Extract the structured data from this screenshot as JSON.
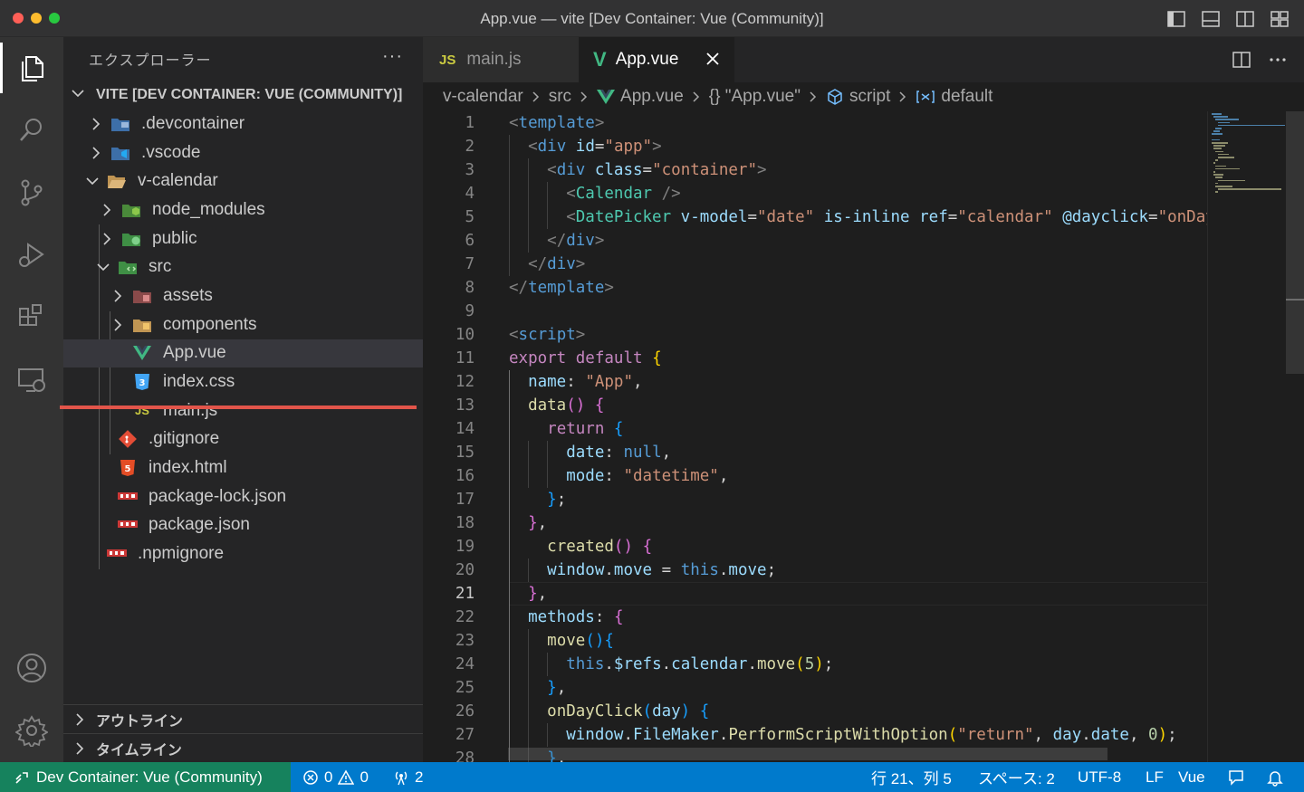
{
  "window": {
    "title": "App.vue — vite [Dev Container: Vue (Community)]"
  },
  "sidebar": {
    "title": "エクスプローラー",
    "more_label": "···",
    "root": "VITE [DEV CONTAINER: VUE (COMMUNITY)]",
    "items": [
      {
        "label": ".devcontainer",
        "expanded": false,
        "icon": "folder-devcontainer-icon"
      },
      {
        "label": ".vscode",
        "expanded": false,
        "icon": "folder-vscode-icon"
      },
      {
        "label": "v-calendar",
        "expanded": true,
        "icon": "folder-open-icon"
      },
      {
        "label": "node_modules",
        "expanded": false,
        "icon": "folder-node-icon"
      },
      {
        "label": "public",
        "expanded": false,
        "icon": "folder-public-icon"
      },
      {
        "label": "src",
        "expanded": true,
        "icon": "folder-src-icon"
      },
      {
        "label": "assets",
        "expanded": false,
        "icon": "folder-assets-icon"
      },
      {
        "label": "components",
        "expanded": false,
        "icon": "folder-components-icon"
      },
      {
        "label": "App.vue",
        "icon": "vue-file-icon",
        "selected": true
      },
      {
        "label": "index.css",
        "icon": "css-file-icon"
      },
      {
        "label": "main.js",
        "icon": "js-file-icon"
      },
      {
        "label": ".gitignore",
        "icon": "git-file-icon"
      },
      {
        "label": "index.html",
        "icon": "html-file-icon"
      },
      {
        "label": "package-lock.json",
        "icon": "npm-file-icon"
      },
      {
        "label": "package.json",
        "icon": "npm-file-icon"
      },
      {
        "label": ".npmignore",
        "icon": "npm-file-icon"
      }
    ],
    "sections": [
      "アウトライン",
      "タイムライン"
    ]
  },
  "tabs": [
    {
      "label": "main.js",
      "badge": "JS",
      "active": false
    },
    {
      "label": "App.vue",
      "badge": "V",
      "active": true
    }
  ],
  "breadcrumb": [
    "v-calendar",
    "src",
    "App.vue",
    "{} \"App.vue\"",
    "script",
    "default"
  ],
  "editor": {
    "current_line": 21,
    "lines": [
      "<template>",
      "  <div id=\"app\">",
      "    <div class=\"container\">",
      "      <Calendar />",
      "      <DatePicker v-model=\"date\" is-inline ref=\"calendar\" @dayclick=\"onDay",
      "    </div>",
      "  </div>",
      "</template>",
      "",
      "<script>",
      "export default {",
      "  name: \"App\",",
      "  data() {",
      "    return {",
      "      date: null,",
      "      mode: \"datetime\",",
      "    };",
      "  },",
      "    created() {",
      "    window.move = this.move;",
      "  },",
      "  methods: {",
      "    move(){",
      "      this.$refs.calendar.move(5);",
      "    },",
      "    onDayClick(day) {",
      "      window.FileMaker.PerformScriptWithOption(\"return\", day.date, 0);",
      "    },"
    ]
  },
  "statusbar": {
    "remote": "Dev Container: Vue (Community)",
    "errors": "0",
    "warnings": "0",
    "ports": "2",
    "position": "行 21、列 5",
    "spaces": "スペース: 2",
    "encoding": "UTF-8",
    "eol": "LF",
    "language": "Vue"
  },
  "colors": {
    "statusbar": "#007acc",
    "remote": "#16825d",
    "selection_underline": "#e2554a",
    "vue": "#41b883"
  }
}
